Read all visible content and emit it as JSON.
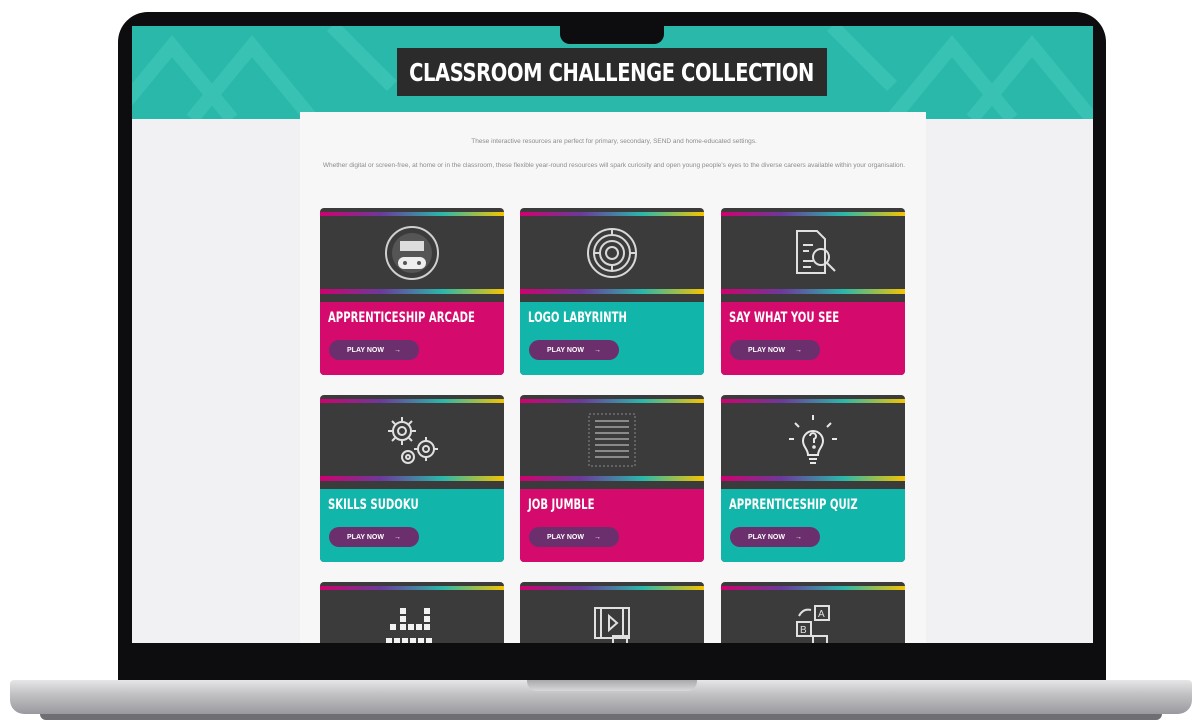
{
  "page": {
    "title": "CLASSROOM CHALLENGE COLLECTION",
    "intro_line1": "These interactive resources are perfect for primary, secondary, SEND and home-educated settings.",
    "intro_line2": "Whether digital or screen-free, at home or in the classroom, these flexible year-round resources will spark curiosity and open young people's eyes to the diverse careers available within your organisation."
  },
  "colors": {
    "hero": "#2ab8aa",
    "pink": "#d40a6c",
    "teal": "#12b5a9",
    "button": "#6b2f6e",
    "card_dark": "#3b3b3b"
  },
  "cards": [
    {
      "title": "APPRENTICESHIP ARCADE",
      "button": "PLAY NOW",
      "icon": "arcade-controller-icon",
      "color": "pink"
    },
    {
      "title": "LOGO LABYRINTH",
      "button": "PLAY NOW",
      "icon": "maze-icon",
      "color": "teal"
    },
    {
      "title": "SAY WHAT YOU SEE",
      "button": "PLAY NOW",
      "icon": "document-search-icon",
      "color": "pink"
    },
    {
      "title": "SKILLS SUDOKU",
      "button": "PLAY NOW",
      "icon": "gears-icon",
      "color": "teal"
    },
    {
      "title": "JOB JUMBLE",
      "button": "PLAY NOW",
      "icon": "word-search-icon",
      "color": "pink"
    },
    {
      "title": "APPRENTICESHIP QUIZ",
      "button": "PLAY NOW",
      "icon": "lightbulb-question-icon",
      "color": "teal"
    },
    {
      "title": "",
      "button": "",
      "icon": "crossword-icon",
      "color": ""
    },
    {
      "title": "",
      "button": "",
      "icon": "video-question-icon",
      "color": ""
    },
    {
      "title": "",
      "button": "",
      "icon": "letter-blocks-icon",
      "color": ""
    }
  ]
}
